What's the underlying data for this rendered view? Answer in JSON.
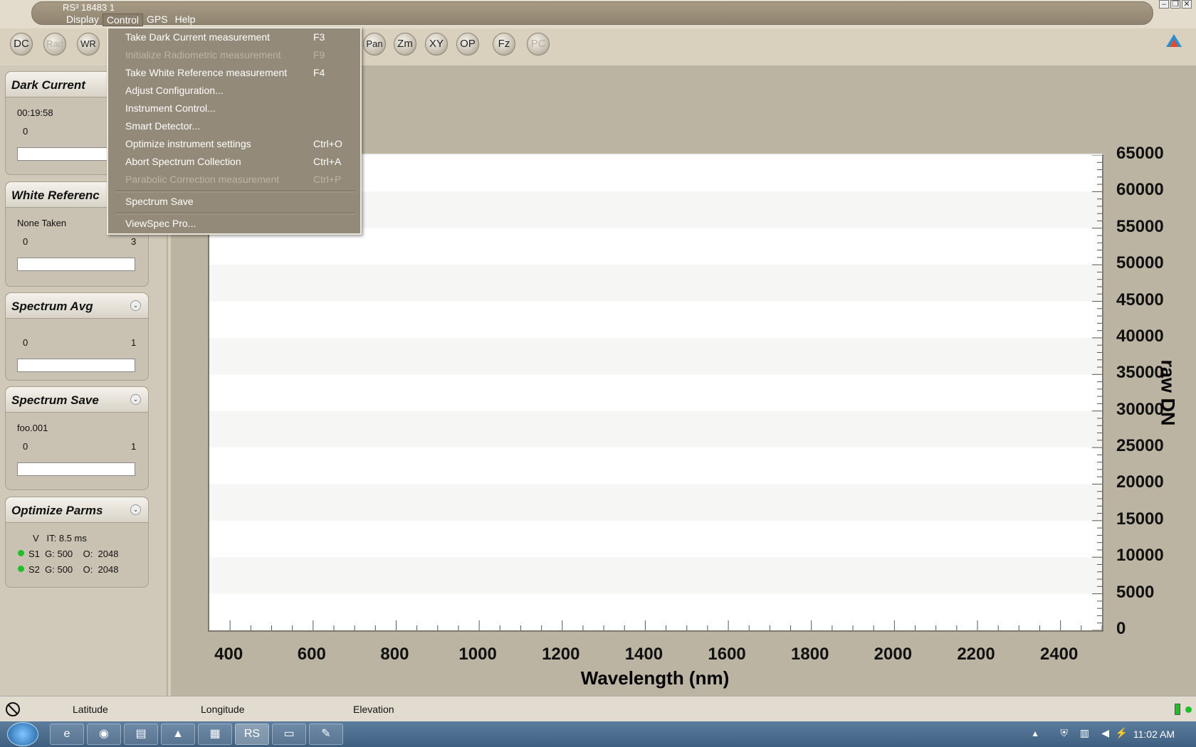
{
  "app": {
    "title": "RS³   18483 1"
  },
  "menubar": {
    "items": [
      "Display",
      "Control",
      "GPS",
      "Help"
    ]
  },
  "toolbar": {
    "buttons": [
      "DC",
      "Rad",
      "WR",
      "Pan",
      "Zm",
      "XY",
      "OP",
      "Fz",
      "PC"
    ]
  },
  "panels": {
    "dark_current": {
      "title": "Dark Current",
      "time": "00:19:58",
      "min": "0"
    },
    "white_reference": {
      "title": "White Referenc",
      "status": "None Taken",
      "min": "0",
      "max": "3"
    },
    "spectrum_avg": {
      "title": "Spectrum Avg",
      "min": "0",
      "max": "1"
    },
    "spectrum_save": {
      "title": "Spectrum Save",
      "filename": "foo.001",
      "min": "0",
      "max": "1"
    },
    "optimize_parms": {
      "title": "Optimize Parms",
      "line1": "V   IT: 8.5 ms",
      "s1": "S1  G: 500    O:  2048",
      "s2": "S2  G: 500    O:  2048"
    }
  },
  "control_menu": {
    "items": [
      {
        "label": "Take Dark Current measurement",
        "key": "F3",
        "enabled": true
      },
      {
        "label": "Initialize Radiometric measurement",
        "key": "F9",
        "enabled": false
      },
      {
        "label": "Take White Reference measurement",
        "key": "F4",
        "enabled": true
      },
      {
        "label": "Adjust Configuration...",
        "key": "",
        "enabled": true
      },
      {
        "label": "Instrument Control...",
        "key": "",
        "enabled": true
      },
      {
        "label": "Smart Detector...",
        "key": "",
        "enabled": true
      },
      {
        "label": "Optimize instrument settings",
        "key": "Ctrl+O",
        "enabled": true
      },
      {
        "label": "Abort Spectrum Collection",
        "key": "Ctrl+A",
        "enabled": true
      },
      {
        "label": "Parabolic Correction measurement",
        "key": "Ctrl+P",
        "enabled": false
      },
      {
        "label": "Spectrum Save",
        "key": "",
        "enabled": true
      },
      {
        "label": "ViewSpec Pro...",
        "key": "",
        "enabled": true
      }
    ]
  },
  "chart_data": {
    "type": "line",
    "xlabel": "Wavelength (nm)",
    "ylabel": "raw DN",
    "xlim": [
      350,
      2500
    ],
    "ylim": [
      0,
      65000
    ],
    "xticks": [
      "400",
      "600",
      "800",
      "1000",
      "1200",
      "1400",
      "1600",
      "1800",
      "2000",
      "2200",
      "2400"
    ],
    "yticks": [
      "0",
      "5000",
      "10000",
      "15000",
      "20000",
      "25000",
      "30000",
      "35000",
      "40000",
      "45000",
      "50000",
      "55000",
      "60000",
      "65000"
    ],
    "series": []
  },
  "statusbar": {
    "latitude": "Latitude",
    "longitude": "Longitude",
    "elevation": "Elevation"
  },
  "taskbar": {
    "clock": "11:02 AM"
  }
}
